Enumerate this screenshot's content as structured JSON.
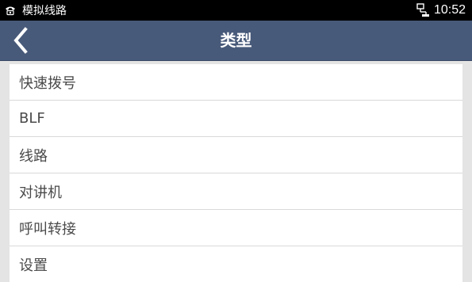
{
  "status_bar": {
    "app_name": "模拟线路",
    "time": "10:52",
    "icons": [
      "phone-icon",
      "network-icon"
    ]
  },
  "header": {
    "title": "类型",
    "back_icon": "chevron-left-icon"
  },
  "list": {
    "items": [
      {
        "label": "快速拨号"
      },
      {
        "label": "BLF"
      },
      {
        "label": "线路"
      },
      {
        "label": "对讲机"
      },
      {
        "label": "呼叫转接"
      },
      {
        "label": "设置"
      }
    ]
  },
  "colors": {
    "status_bar_bg": "#000000",
    "title_bar_bg": "#485a7a",
    "page_bg": "#e4e4e4",
    "list_bg": "#ffffff",
    "item_text": "#4a4a4a",
    "divider": "#d9d9d9"
  }
}
